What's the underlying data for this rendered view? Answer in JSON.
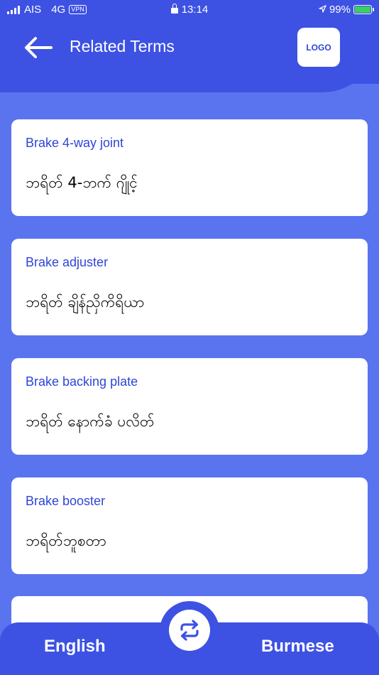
{
  "status_bar": {
    "carrier": "AIS",
    "network": "4G",
    "vpn": "VPN",
    "time": "13:14",
    "battery_percent": "99%",
    "battery_level": 0.99,
    "battery_color": "#3ad15c"
  },
  "header": {
    "title": "Related Terms",
    "logo_text": "LOGO",
    "back_icon": "arrow-left-icon"
  },
  "terms": [
    {
      "english": "Brake 4-way joint",
      "burmese": "ဘရိတ် 4-ဘက် ဂျိုင့်"
    },
    {
      "english": "Brake adjuster",
      "burmese": "ဘရိတ် ချိန်ညှိကိရိယာ"
    },
    {
      "english": "Brake backing plate",
      "burmese": "ဘရိတ် နောက်ခံ ပလိတ်"
    },
    {
      "english": "Brake booster",
      "burmese": "ဘရိတ်ဘူစတာ"
    }
  ],
  "bottom_bar": {
    "source_language": "English",
    "target_language": "Burmese",
    "swap_icon": "swap-icon"
  },
  "colors": {
    "accent": "#3d52e3",
    "background": "#5a74f0",
    "term_text": "#2e45d8"
  }
}
